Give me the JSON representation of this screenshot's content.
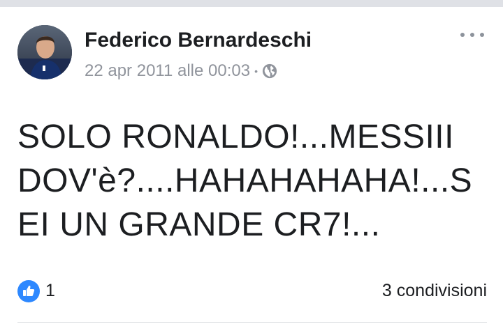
{
  "post": {
    "author": "Federico Bernardeschi",
    "timestamp": "22 apr 2011 alle 00:03",
    "separator": "•",
    "privacy_icon": "globe-icon",
    "text": "SOLO RONALDO!...MESSIII DOV'è?....HAHAHAHAHA!...SEI UN GRANDE CR7!..."
  },
  "reactions": {
    "like_icon": "thumbs-up-icon",
    "like_count": "1",
    "shares": "3 condivisioni"
  },
  "colors": {
    "like_blue": "#2d88ff",
    "meta_gray": "#90949c",
    "text": "#1c1e21"
  }
}
